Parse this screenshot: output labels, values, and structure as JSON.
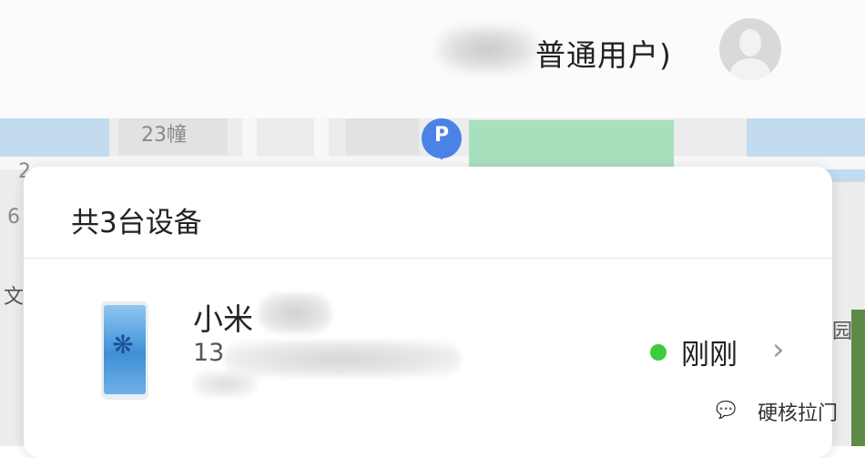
{
  "header": {
    "user_role": "普通用户)"
  },
  "map": {
    "labels": [
      "23幢",
      "2",
      "6",
      "文",
      "园"
    ],
    "parking_label": "P"
  },
  "device_card": {
    "title": "共3台设备",
    "devices": [
      {
        "name_prefix": "小米",
        "number_prefix": "13",
        "status": "刚刚",
        "status_color": "#3ccc3c"
      }
    ]
  },
  "watermark": {
    "icon": "wechat-icon",
    "text": "硬核拉门"
  },
  "colors": {
    "online": "#3ccc3c",
    "map_green": "#a8dfbd",
    "parking_pin": "#4a82e6"
  }
}
